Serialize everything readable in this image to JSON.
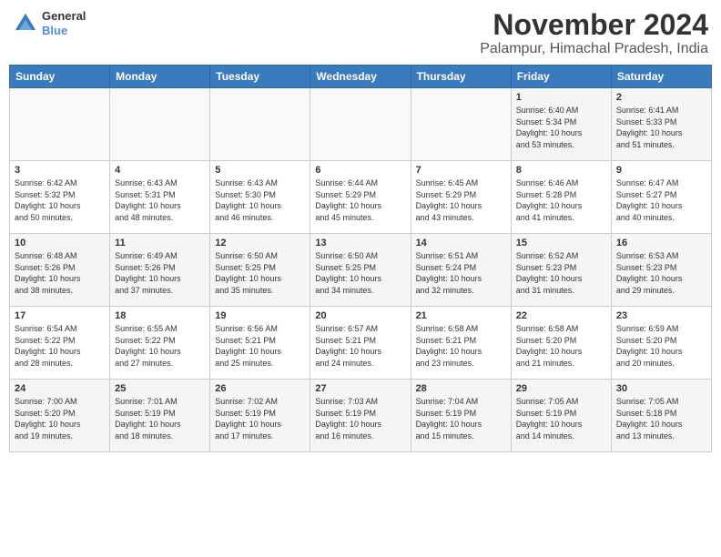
{
  "header": {
    "logo_line1": "General",
    "logo_line2": "Blue",
    "title": "November 2024",
    "subtitle": "Palampur, Himachal Pradesh, India"
  },
  "weekdays": [
    "Sunday",
    "Monday",
    "Tuesday",
    "Wednesday",
    "Thursday",
    "Friday",
    "Saturday"
  ],
  "weeks": [
    [
      {
        "day": "",
        "info": ""
      },
      {
        "day": "",
        "info": ""
      },
      {
        "day": "",
        "info": ""
      },
      {
        "day": "",
        "info": ""
      },
      {
        "day": "",
        "info": ""
      },
      {
        "day": "1",
        "info": "Sunrise: 6:40 AM\nSunset: 5:34 PM\nDaylight: 10 hours\nand 53 minutes."
      },
      {
        "day": "2",
        "info": "Sunrise: 6:41 AM\nSunset: 5:33 PM\nDaylight: 10 hours\nand 51 minutes."
      }
    ],
    [
      {
        "day": "3",
        "info": "Sunrise: 6:42 AM\nSunset: 5:32 PM\nDaylight: 10 hours\nand 50 minutes."
      },
      {
        "day": "4",
        "info": "Sunrise: 6:43 AM\nSunset: 5:31 PM\nDaylight: 10 hours\nand 48 minutes."
      },
      {
        "day": "5",
        "info": "Sunrise: 6:43 AM\nSunset: 5:30 PM\nDaylight: 10 hours\nand 46 minutes."
      },
      {
        "day": "6",
        "info": "Sunrise: 6:44 AM\nSunset: 5:29 PM\nDaylight: 10 hours\nand 45 minutes."
      },
      {
        "day": "7",
        "info": "Sunrise: 6:45 AM\nSunset: 5:29 PM\nDaylight: 10 hours\nand 43 minutes."
      },
      {
        "day": "8",
        "info": "Sunrise: 6:46 AM\nSunset: 5:28 PM\nDaylight: 10 hours\nand 41 minutes."
      },
      {
        "day": "9",
        "info": "Sunrise: 6:47 AM\nSunset: 5:27 PM\nDaylight: 10 hours\nand 40 minutes."
      }
    ],
    [
      {
        "day": "10",
        "info": "Sunrise: 6:48 AM\nSunset: 5:26 PM\nDaylight: 10 hours\nand 38 minutes."
      },
      {
        "day": "11",
        "info": "Sunrise: 6:49 AM\nSunset: 5:26 PM\nDaylight: 10 hours\nand 37 minutes."
      },
      {
        "day": "12",
        "info": "Sunrise: 6:50 AM\nSunset: 5:25 PM\nDaylight: 10 hours\nand 35 minutes."
      },
      {
        "day": "13",
        "info": "Sunrise: 6:50 AM\nSunset: 5:25 PM\nDaylight: 10 hours\nand 34 minutes."
      },
      {
        "day": "14",
        "info": "Sunrise: 6:51 AM\nSunset: 5:24 PM\nDaylight: 10 hours\nand 32 minutes."
      },
      {
        "day": "15",
        "info": "Sunrise: 6:52 AM\nSunset: 5:23 PM\nDaylight: 10 hours\nand 31 minutes."
      },
      {
        "day": "16",
        "info": "Sunrise: 6:53 AM\nSunset: 5:23 PM\nDaylight: 10 hours\nand 29 minutes."
      }
    ],
    [
      {
        "day": "17",
        "info": "Sunrise: 6:54 AM\nSunset: 5:22 PM\nDaylight: 10 hours\nand 28 minutes."
      },
      {
        "day": "18",
        "info": "Sunrise: 6:55 AM\nSunset: 5:22 PM\nDaylight: 10 hours\nand 27 minutes."
      },
      {
        "day": "19",
        "info": "Sunrise: 6:56 AM\nSunset: 5:21 PM\nDaylight: 10 hours\nand 25 minutes."
      },
      {
        "day": "20",
        "info": "Sunrise: 6:57 AM\nSunset: 5:21 PM\nDaylight: 10 hours\nand 24 minutes."
      },
      {
        "day": "21",
        "info": "Sunrise: 6:58 AM\nSunset: 5:21 PM\nDaylight: 10 hours\nand 23 minutes."
      },
      {
        "day": "22",
        "info": "Sunrise: 6:58 AM\nSunset: 5:20 PM\nDaylight: 10 hours\nand 21 minutes."
      },
      {
        "day": "23",
        "info": "Sunrise: 6:59 AM\nSunset: 5:20 PM\nDaylight: 10 hours\nand 20 minutes."
      }
    ],
    [
      {
        "day": "24",
        "info": "Sunrise: 7:00 AM\nSunset: 5:20 PM\nDaylight: 10 hours\nand 19 minutes."
      },
      {
        "day": "25",
        "info": "Sunrise: 7:01 AM\nSunset: 5:19 PM\nDaylight: 10 hours\nand 18 minutes."
      },
      {
        "day": "26",
        "info": "Sunrise: 7:02 AM\nSunset: 5:19 PM\nDaylight: 10 hours\nand 17 minutes."
      },
      {
        "day": "27",
        "info": "Sunrise: 7:03 AM\nSunset: 5:19 PM\nDaylight: 10 hours\nand 16 minutes."
      },
      {
        "day": "28",
        "info": "Sunrise: 7:04 AM\nSunset: 5:19 PM\nDaylight: 10 hours\nand 15 minutes."
      },
      {
        "day": "29",
        "info": "Sunrise: 7:05 AM\nSunset: 5:19 PM\nDaylight: 10 hours\nand 14 minutes."
      },
      {
        "day": "30",
        "info": "Sunrise: 7:05 AM\nSunset: 5:18 PM\nDaylight: 10 hours\nand 13 minutes."
      }
    ]
  ]
}
